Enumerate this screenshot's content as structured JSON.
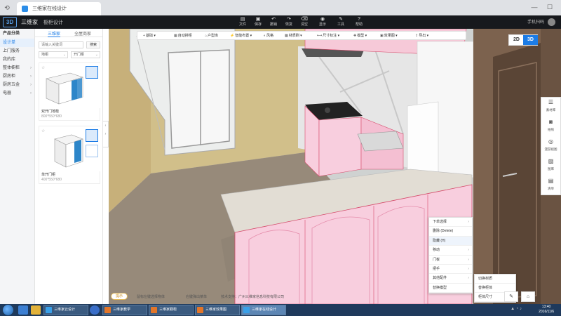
{
  "browser": {
    "tab_title": "三维家在线设计",
    "back_icon": "back-arrow-icon",
    "refresh_icon": "refresh-icon",
    "win_minimize": "—",
    "win_maximize": "☐"
  },
  "app": {
    "logo_text": "3D",
    "brand": "三维家",
    "title": "橱柜设计",
    "tools": [
      {
        "label": "文件",
        "icon": "▤"
      },
      {
        "label": "保存",
        "icon": "▣"
      },
      {
        "label": "撤销",
        "icon": "↶"
      },
      {
        "label": "恢复",
        "icon": "↷"
      },
      {
        "label": "清空",
        "icon": "⌫"
      },
      {
        "label": "显示",
        "icon": "◉"
      },
      {
        "label": "工具",
        "icon": "✎"
      },
      {
        "label": "帮助",
        "icon": "?"
      }
    ],
    "right_info": "手机扫码"
  },
  "left_nav": {
    "header": "产品分类",
    "items": [
      {
        "label": "设计单",
        "active": true
      },
      {
        "label": "上门服务",
        "active": false
      },
      {
        "label": "我的库",
        "active": false
      },
      {
        "label": "整体橱柜",
        "active": false,
        "has_arrow": true
      },
      {
        "label": "厨房柜",
        "active": false,
        "has_arrow": true
      },
      {
        "label": "厨房五金",
        "active": false,
        "has_arrow": true
      },
      {
        "label": "电器",
        "active": false,
        "has_arrow": true
      }
    ]
  },
  "catalog": {
    "tabs": [
      "三维家",
      "全屋商家"
    ],
    "search_placeholder": "请输入关键词",
    "search_button": "搜索",
    "filter_1": "地柜",
    "filter_2": "开门柜",
    "cards": [
      {
        "name": "双开门地柜",
        "size": "800*550*680"
      },
      {
        "name": "单开门柜",
        "size": "400*550*680"
      }
    ]
  },
  "viewport_toolbar": [
    {
      "label": "基础",
      "icon": "+"
    },
    {
      "label": "自动排柜",
      "icon": "▦"
    },
    {
      "label": "户型库",
      "icon": "⌂"
    },
    {
      "label": "智能布置",
      "icon": "⚡"
    },
    {
      "label": "风格",
      "icon": "◐"
    },
    {
      "label": "材质刷",
      "icon": "▩"
    },
    {
      "label": "尺寸标注",
      "icon": "⟷"
    },
    {
      "label": "模型",
      "icon": "✚"
    },
    {
      "label": "效果图",
      "icon": "▣"
    },
    {
      "label": "导出",
      "icon": "⇪"
    }
  ],
  "view_mode": {
    "d2": "2D",
    "d3": "3D",
    "active": "3D"
  },
  "context_menu": [
    {
      "label": "下单选择",
      "submenu": true
    },
    {
      "label": "删除 (Delete)",
      "submenu": false
    },
    {
      "label": "隐藏 (H)",
      "submenu": false,
      "highlight": true
    },
    {
      "label": "移动",
      "submenu": true
    },
    {
      "label": "门板",
      "submenu": true
    },
    {
      "label": "把手",
      "submenu": true
    },
    {
      "label": "其他配件",
      "submenu": true
    },
    {
      "label": "替换模型",
      "submenu": false
    }
  ],
  "submenu": [
    "切换材质",
    "替换柜体",
    "柜体尺寸"
  ],
  "bottom_hint": {
    "pill": "提示",
    "text_1": "鼠标左键选择物体",
    "text_2": "右键弹出菜单",
    "text_3": "技术支持：广州三维家信息科技有限公司"
  },
  "right_rail": [
    {
      "label": "素材库",
      "icon": "☰"
    },
    {
      "label": "拍照",
      "icon": "◙"
    },
    {
      "label": "漫游视图",
      "icon": "◎"
    },
    {
      "label": "图库",
      "icon": "▨"
    },
    {
      "label": "清单",
      "icon": "▤"
    }
  ],
  "taskbar": {
    "items": [
      {
        "label": "三维家云设计",
        "color": "#3aa0e8",
        "active": false
      },
      {
        "label": "三维家教学",
        "color": "#e2762a",
        "active": false
      },
      {
        "label": "三维家橱柜",
        "color": "#e2762a",
        "active": false
      },
      {
        "label": "三维家效果图",
        "color": "#e2762a",
        "active": false
      },
      {
        "label": "三维家在线设计",
        "color": "#3aa0e8",
        "active": true
      }
    ],
    "time": "13:40",
    "date": "2016/11/6"
  }
}
